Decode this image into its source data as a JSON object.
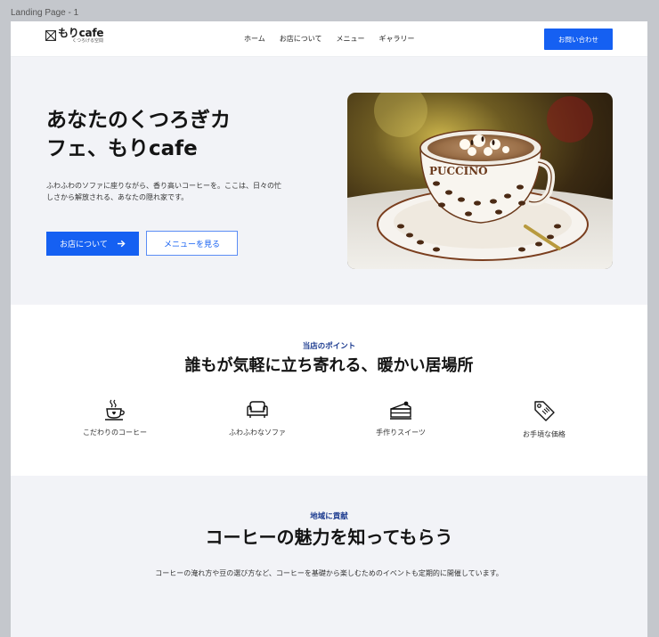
{
  "frame_label": "Landing Page - 1",
  "header": {
    "logo_name": "もりcafe",
    "logo_sub": "くつろげる空間",
    "nav": [
      "ホーム",
      "お店について",
      "メニュー",
      "ギャラリー"
    ],
    "contact_label": "お問い合わせ"
  },
  "hero": {
    "title_line1": "あなたのくつろぎカ",
    "title_line2": "フェ、もりcafe",
    "desc_line1": "ふわふわのソファに座りながら、香り高いコーヒーを。ここは、日々の忙",
    "desc_line2": "しさから解放される、あなたの隠れ家です。",
    "primary_button": "お店について",
    "secondary_button": "メニューを見る",
    "image_cup_text": "PUCCINO"
  },
  "points": {
    "eyebrow": "当店のポイント",
    "title": "誰もが気軽に立ち寄れる、暖かい居場所",
    "features": [
      {
        "label": "こだわりのコーヒー",
        "icon": "coffee-cup-icon"
      },
      {
        "label": "ふわふわなソファ",
        "icon": "sofa-icon"
      },
      {
        "label": "手作りスイーツ",
        "icon": "cake-icon"
      },
      {
        "label": "お手頃な価格",
        "icon": "price-tag-icon"
      }
    ]
  },
  "community": {
    "eyebrow": "地域に貢献",
    "title": "コーヒーの魅力を知ってもらう",
    "desc": "コーヒーの淹れ方や豆の選び方など、コーヒーを基礎から楽しむためのイベントも定期的に開催しています。"
  },
  "colors": {
    "accent": "#1560f2",
    "eyebrow": "#1b3a8f",
    "section_bg": "#f2f3f7"
  }
}
